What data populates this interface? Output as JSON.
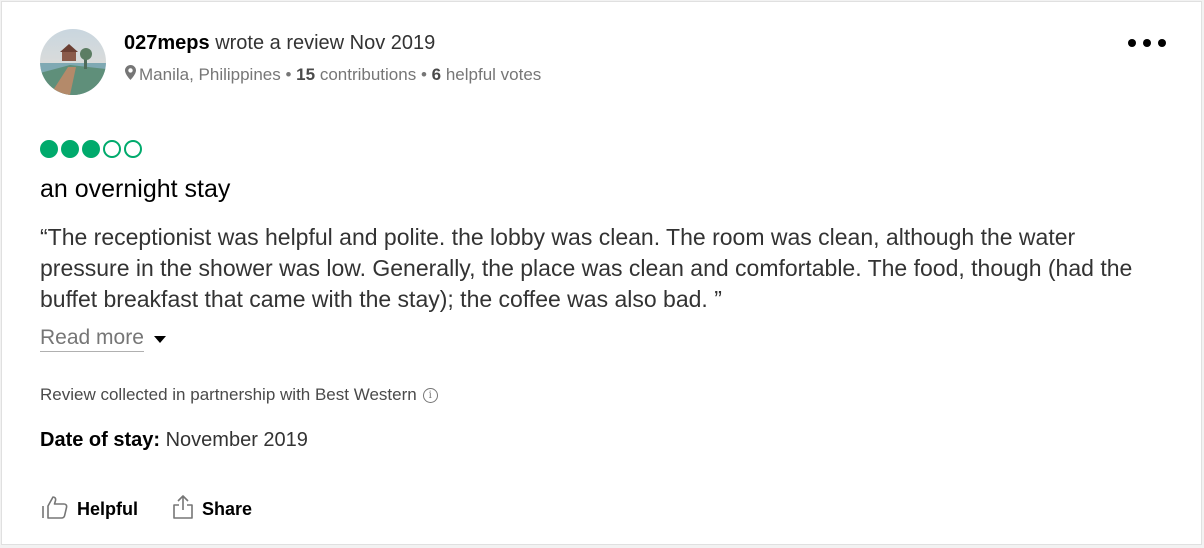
{
  "review": {
    "author": {
      "name": "027meps",
      "action_text": "wrote a review Nov 2019",
      "location": "Manila, Philippines",
      "contributions_count": "15",
      "contributions_label": "contributions",
      "helpful_votes_count": "6",
      "helpful_votes_label": "helpful votes",
      "separator": "•"
    },
    "rating": {
      "value": 3,
      "max": 5
    },
    "title": "an overnight stay",
    "body": "“The receptionist was helpful and polite. the lobby was clean. The room was clean, although the water pressure in the shower was low. Generally, the place was clean and comfortable. The food, though (had the buffet breakfast that came with the stay); the coffee was also bad. ”",
    "read_more_label": "Read more",
    "partnership_text": "Review collected in partnership with Best Western",
    "date_of_stay_label": "Date of stay:",
    "date_of_stay_value": "November 2019",
    "actions": {
      "helpful_label": "Helpful",
      "share_label": "Share"
    }
  },
  "icons": {
    "more": "more-options-icon",
    "pin": "location-pin-icon",
    "info": "info-icon",
    "thumbs_up": "thumbs-up-icon",
    "share": "share-icon",
    "caret": "caret-down-icon"
  },
  "colors": {
    "rating_green": "#00aa6c",
    "secondary_text": "#767676"
  }
}
